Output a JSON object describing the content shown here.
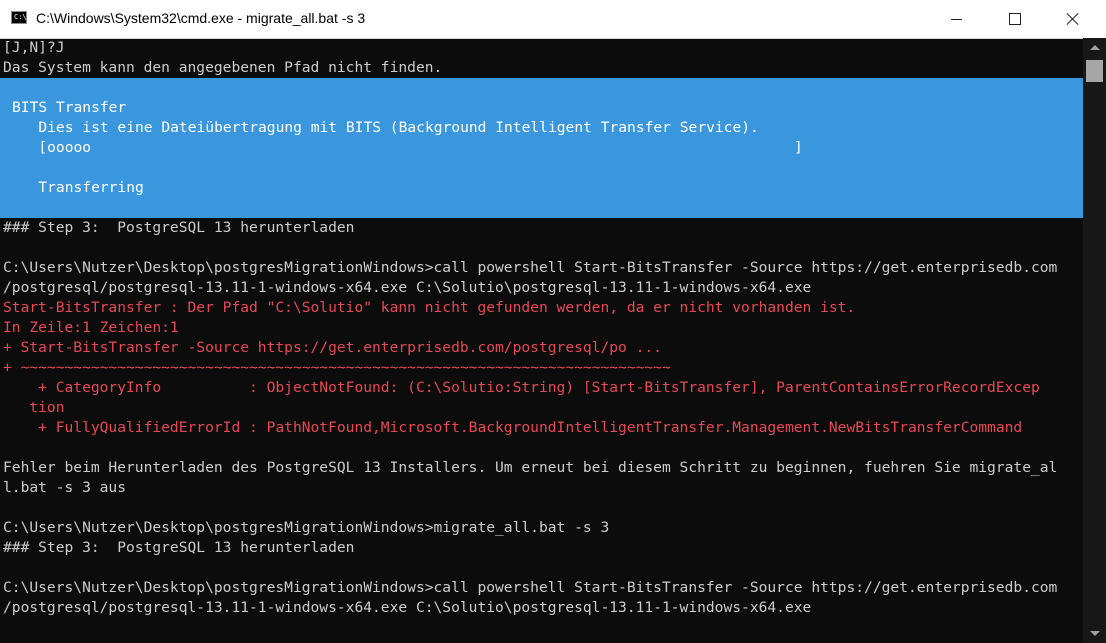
{
  "window": {
    "title": "C:\\Windows\\System32\\cmd.exe - migrate_all.bat  -s 3",
    "icon_label": "C:\\",
    "icon": "cmd-icon",
    "controls": [
      "minimize-icon",
      "maximize-icon",
      "close-icon"
    ]
  },
  "console": {
    "pre_lines": [
      "[J,N]?J",
      "Das System kann den angegebenen Pfad nicht finden."
    ],
    "progress": {
      "heading": "BITS Transfer",
      "description": "   Dies ist eine Dateiübertragung mit BITS (Background Intelligent Transfer Service).",
      "bar": "   [ooooo                                                                                ]",
      "status": "   Transferring"
    },
    "lines": [
      {
        "text": "### Step 3:  PostgreSQL 13 herunterladen",
        "type": "normal"
      },
      {
        "text": "",
        "type": "normal"
      },
      {
        "text": "C:\\Users\\Nutzer\\Desktop\\postgresMigrationWindows>call powershell Start-BitsTransfer -Source https://get.enterprisedb.com",
        "type": "normal"
      },
      {
        "text": "/postgresql/postgresql-13.11-1-windows-x64.exe C:\\Solutio\\postgresql-13.11-1-windows-x64.exe",
        "type": "normal"
      },
      {
        "text": "Start-BitsTransfer : Der Pfad \"C:\\Solutio\" kann nicht gefunden werden, da er nicht vorhanden ist.",
        "type": "error"
      },
      {
        "text": "In Zeile:1 Zeichen:1",
        "type": "error"
      },
      {
        "text": "+ Start-BitsTransfer -Source https://get.enterprisedb.com/postgresql/po ...",
        "type": "error"
      },
      {
        "text": "+ ~~~~~~~~~~~~~~~~~~~~~~~~~~~~~~~~~~~~~~~~~~~~~~~~~~~~~~~~~~~~~~~~~~~~~~~~~~",
        "type": "error"
      },
      {
        "text": "    + CategoryInfo          : ObjectNotFound: (C:\\Solutio:String) [Start-BitsTransfer], ParentContainsErrorRecordExcep",
        "type": "error"
      },
      {
        "text": "   tion",
        "type": "error"
      },
      {
        "text": "    + FullyQualifiedErrorId : PathNotFound,Microsoft.BackgroundIntelligentTransfer.Management.NewBitsTransferCommand",
        "type": "error"
      },
      {
        "text": "",
        "type": "normal"
      },
      {
        "text": "Fehler beim Herunterladen des PostgreSQL 13 Installers. Um erneut bei diesem Schritt zu beginnen, fuehren Sie migrate_al",
        "type": "normal"
      },
      {
        "text": "l.bat -s 3 aus",
        "type": "normal"
      },
      {
        "text": "",
        "type": "normal"
      },
      {
        "text": "C:\\Users\\Nutzer\\Desktop\\postgresMigrationWindows>migrate_all.bat -s 3",
        "type": "normal"
      },
      {
        "text": "### Step 3:  PostgreSQL 13 herunterladen",
        "type": "normal"
      },
      {
        "text": "",
        "type": "normal"
      },
      {
        "text": "C:\\Users\\Nutzer\\Desktop\\postgresMigrationWindows>call powershell Start-BitsTransfer -Source https://get.enterprisedb.com",
        "type": "normal"
      },
      {
        "text": "/postgresql/postgresql-13.11-1-windows-x64.exe C:\\Solutio\\postgresql-13.11-1-windows-x64.exe",
        "type": "normal"
      }
    ]
  },
  "colors": {
    "background": "#0c0c0c",
    "text": "#cccccc",
    "error": "#e74856",
    "progress_bg": "#3a96dd"
  }
}
